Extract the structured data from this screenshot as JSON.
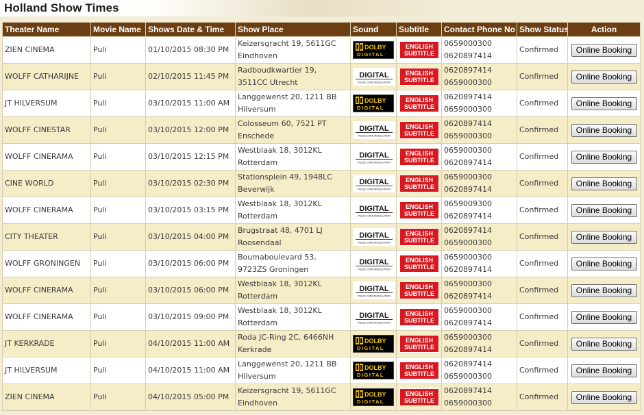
{
  "header": {
    "title": "Holland Show Times"
  },
  "columns": {
    "theater": "Theater Name",
    "movie": "Movie Name",
    "datetime": "Shows Date & Time",
    "place": "Show Place",
    "sound": "Sound",
    "subtitle": "Subtitle",
    "phone": "Contact Phone No",
    "status": "Show Status",
    "action": "Action"
  },
  "logos": {
    "dolby": {
      "top": "DOLBY",
      "bottom": "DIGITAL",
      "color": "#f2c500"
    },
    "pcm": {
      "top": "DIGITAL",
      "bottom": "PULSE CODE MODULATION"
    },
    "subtitle": {
      "line1": "ENGLISH",
      "line2": "SUBTITLE",
      "color": "#d81920"
    }
  },
  "colors": {
    "header_row": "#6b3e14",
    "row_odd": "#ffffff",
    "row_even": "#f5ecc8",
    "page_bg": "#f3ecd6"
  },
  "shows": [
    {
      "theater": "ZIEN CINEMA",
      "movie": "Puli",
      "datetime": "01/10/2015 08:30 PM",
      "place1": "Keizersgracht 19, 5611GC",
      "place2": "Eindhoven",
      "sound": "dolby",
      "phone1": "0659000300",
      "phone2": "0620897414",
      "status": "Confirmed",
      "action": "Online Booking"
    },
    {
      "theater": "WOLFF CATHARIJNE",
      "movie": "Puli",
      "datetime": "02/10/2015 11:45 PM",
      "place1": "Radboudkwartier 19,",
      "place2": "3511CC Utrecht",
      "sound": "pcm",
      "phone1": "0620897414",
      "phone2": "0659000300",
      "status": "Confirmed",
      "action": "Online Booking"
    },
    {
      "theater": "JT HILVERSUM",
      "movie": "Puli",
      "datetime": "03/10/2015 11:00 AM",
      "place1": "Langgewenst 20, 1211 BB",
      "place2": "Hilversum",
      "sound": "dolby",
      "phone1": "0620897414",
      "phone2": "0659000300",
      "status": "Confirmed",
      "action": "Online Booking"
    },
    {
      "theater": "WOLFF CINESTAR",
      "movie": "Puli",
      "datetime": "03/10/2015 12:00 PM",
      "place1": "Colosseum 60, 7521 PT",
      "place2": "Enschede",
      "sound": "pcm",
      "phone1": "0620897414",
      "phone2": "0659000300",
      "status": "Confirmed",
      "action": "Online Booking"
    },
    {
      "theater": "WOLFF CINERAMA",
      "movie": "Puli",
      "datetime": "03/10/2015 12:15 PM",
      "place1": "Westblaak 18, 3012KL",
      "place2": "Rotterdam",
      "sound": "pcm",
      "phone1": "0659000300",
      "phone2": "0620897414",
      "status": "Confirmed",
      "action": "Online Booking"
    },
    {
      "theater": "CINE WORLD",
      "movie": "Puli",
      "datetime": "03/10/2015 02:30 PM",
      "place1": "Stationsplein 49, 1948LC",
      "place2": "Beverwijk",
      "sound": "pcm",
      "phone1": "0659000300",
      "phone2": "0620897414",
      "status": "Confirmed",
      "action": "Online Booking"
    },
    {
      "theater": "WOLFF CINERAMA",
      "movie": "Puli",
      "datetime": "03/10/2015 03:15 PM",
      "place1": "Westblaak 18, 3012KL",
      "place2": "Rotterdam",
      "sound": "pcm",
      "phone1": "0659009300",
      "phone2": "0620897414",
      "status": "Confirmed",
      "action": "Online Booking"
    },
    {
      "theater": "CITY THEATER",
      "movie": "Puli",
      "datetime": "03/10/2015 04:00 PM",
      "place1": "Brugstraat 48, 4701 LJ",
      "place2": "Roosendaal",
      "sound": "pcm",
      "phone1": "0620897414",
      "phone2": "0659000300",
      "status": "Confirmed",
      "action": "Online Booking"
    },
    {
      "theater": "WOLFF GRONINGEN",
      "movie": "Puli",
      "datetime": "03/10/2015 06:00 PM",
      "place1": "Boumaboulevard 53,",
      "place2": "9723ZS Groningen",
      "sound": "pcm",
      "phone1": "0659000300",
      "phone2": "0620897414",
      "status": "Confirmed",
      "action": "Online Booking"
    },
    {
      "theater": "WOLFF CINERAMA",
      "movie": "Puli",
      "datetime": "03/10/2015 06:00 PM",
      "place1": "Westblaak 18, 3012KL",
      "place2": "Rotterdam",
      "sound": "pcm",
      "phone1": "0659000300",
      "phone2": "0620897414",
      "status": "Confirmed",
      "action": "Online Booking"
    },
    {
      "theater": "WOLFF CINERAMA",
      "movie": "Puli",
      "datetime": "03/10/2015 09:00 PM",
      "place1": "Westblaak 18, 3012KL",
      "place2": "Rotterdam",
      "sound": "pcm",
      "phone1": "0659000300",
      "phone2": "0620897414",
      "status": "Confirmed",
      "action": "Online Booking"
    },
    {
      "theater": "JT KERKRADE",
      "movie": "Puli",
      "datetime": "04/10/2015 11:00 AM",
      "place1": "Roda JC-Ring 2C, 6466NH",
      "place2": "Kerkrade",
      "sound": "dolby",
      "phone1": "0659000300",
      "phone2": "0620897414",
      "status": "Confirmed",
      "action": "Online Booking"
    },
    {
      "theater": "JT HILVERSUM",
      "movie": "Puli",
      "datetime": "04/10/2015 11:00 AM",
      "place1": "Langgewenst 20, 1211 BB",
      "place2": "Hilversum",
      "sound": "dolby",
      "phone1": "0620897414",
      "phone2": "0659000300",
      "status": "Confirmed",
      "action": "Online Booking"
    },
    {
      "theater": "ZIEN CINEMA",
      "movie": "Puli",
      "datetime": "04/10/2015 05:00 PM",
      "place1": "Keizersgracht 19, 5611GC",
      "place2": "Eindhoven",
      "sound": "dolby",
      "phone1": "0620897414",
      "phone2": "0659000300",
      "status": "Confirmed",
      "action": "Online Booking"
    }
  ]
}
